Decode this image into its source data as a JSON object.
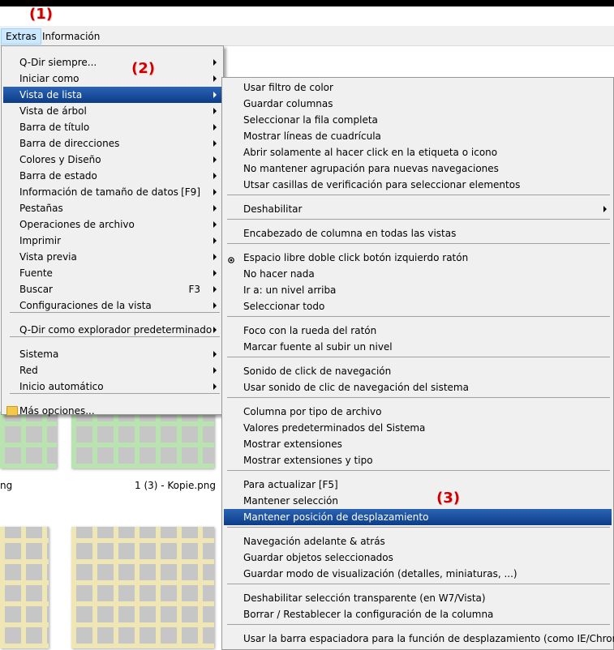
{
  "annotations": [
    "(1)",
    "(2)",
    "(3)"
  ],
  "menubar": {
    "items": [
      "Extras",
      "Información"
    ]
  },
  "files": {
    "label_left": "ng",
    "label_right": "1 (3) - Kopie.png"
  },
  "main_menu": {
    "items": [
      {
        "label": "Q-Dir siempre...",
        "shortcut": "",
        "submenu": true
      },
      {
        "label": "Iniciar como",
        "shortcut": "",
        "submenu": true
      },
      {
        "label": "Vista de lista",
        "shortcut": "",
        "submenu": true
      },
      {
        "label": "Vista de árbol",
        "shortcut": "",
        "submenu": true
      },
      {
        "label": "Barra de título",
        "shortcut": "",
        "submenu": true
      },
      {
        "label": "Barra de direcciones",
        "shortcut": "",
        "submenu": true
      },
      {
        "label": "Colores y Diseño",
        "shortcut": "",
        "submenu": true
      },
      {
        "label": "Barra de estado",
        "shortcut": "",
        "submenu": true
      },
      {
        "label": "Información de tamaño de datos",
        "shortcut": "[F9]",
        "submenu": true
      },
      {
        "label": "Pestañas",
        "shortcut": "",
        "submenu": true
      },
      {
        "label": "Operaciones de archivo",
        "shortcut": "",
        "submenu": true
      },
      {
        "label": "Imprimir",
        "shortcut": "",
        "submenu": true
      },
      {
        "label": "Vista previa",
        "shortcut": "",
        "submenu": true
      },
      {
        "label": "Fuente",
        "shortcut": "",
        "submenu": true
      },
      {
        "label": "Buscar",
        "shortcut": "F3",
        "submenu": true
      },
      {
        "label": "Configuraciones de la vista",
        "shortcut": "",
        "submenu": true
      },
      {
        "label": "Q-Dir como explorador predeterminado",
        "shortcut": "",
        "submenu": true
      },
      {
        "label": "Sistema",
        "shortcut": "",
        "submenu": true
      },
      {
        "label": "Red",
        "shortcut": "",
        "submenu": true
      },
      {
        "label": "Inicio automático",
        "shortcut": "",
        "submenu": true
      },
      {
        "label": "Más opciones...",
        "shortcut": "",
        "submenu": false
      }
    ]
  },
  "sub_menu": {
    "items": [
      "Usar filtro de color",
      "Guardar columnas",
      "Seleccionar la fila completa",
      "Mostrar líneas de cuadrícula",
      "Abrir solamente al hacer click en la etiqueta o icono",
      "No mantener agrupación para nuevas navegaciones",
      "Utsar casillas de verificación para seleccionar elementos",
      "Deshabilitar",
      "Encabezado de columna en todas las vistas",
      "Espacio libre doble click botón izquierdo ratón",
      "No hacer nada",
      "Ir a: un nivel arriba",
      "Seleccionar todo",
      "Foco con la rueda del ratón",
      "Marcar fuente al subir un nivel",
      "Sonido de click de navegación",
      "Usar sonido de clic de navegación del sistema",
      "Columna por tipo de archivo",
      "Valores predeterminados del Sistema",
      "Mostrar extensiones",
      "Mostrar extensiones y tipo",
      "Para actualizar [F5]",
      "Mantener selección",
      "Mantener posición de desplazamiento",
      "Navegación adelante & atrás",
      "Guardar objetos seleccionados",
      "Guardar modo de visualización (detalles, miniaturas, ...)",
      "Deshabilitar selección transparente (en W7/Vista)",
      "Borrar / Restablecer la configuración de la columna",
      "Usar la barra espaciadora para la función de desplazamiento (como IE/Chrome)"
    ]
  },
  "colors": {
    "highlight": "#1a4f9c",
    "annotation": "#cc0000",
    "menu_bg": "#f0f0f0"
  },
  "icons": {
    "more_options": "folder-icon",
    "radio_selected": "radio-dot-icon"
  }
}
